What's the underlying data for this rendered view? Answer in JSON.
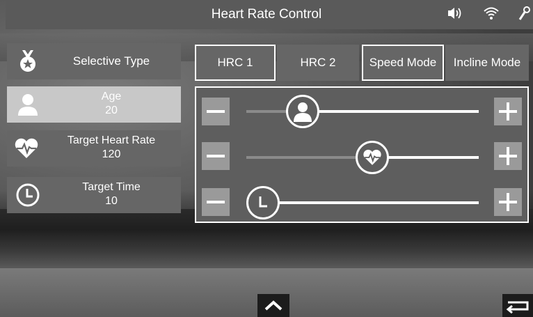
{
  "header": {
    "title": "Heart Rate Control",
    "icons": [
      "volume-icon",
      "wifi-icon",
      "wrench-icon"
    ]
  },
  "left_panel": {
    "items": [
      {
        "icon": "medal-icon",
        "label": "Selective Type",
        "value": "",
        "active": false
      },
      {
        "icon": "person-icon",
        "label": "Age",
        "value": "20",
        "active": true
      },
      {
        "icon": "heart-icon",
        "label": "Target Heart Rate",
        "value": "120",
        "active": false
      },
      {
        "icon": "clock-icon",
        "label": "Target Time",
        "value": "10",
        "active": false
      }
    ]
  },
  "tabs": [
    {
      "label": "HRC 1",
      "selected": true
    },
    {
      "label": "HRC 2",
      "selected": false
    },
    {
      "label": "Speed Mode",
      "selected": true
    },
    {
      "label": "Incline Mode",
      "selected": false
    }
  ],
  "sliders": [
    {
      "name": "age",
      "icon": "person-icon",
      "fraction": 0.17
    },
    {
      "name": "target-heart-rate",
      "icon": "heart-icon",
      "fraction": 0.47
    },
    {
      "name": "target-time",
      "icon": "clock-icon",
      "fraction": 0.0
    }
  ],
  "footer": {
    "up_icon": "chevron-up-icon",
    "back_icon": "return-icon"
  },
  "colors": {
    "card": "#666666",
    "card_active": "#c8c8c8",
    "button": "#9a9a9a",
    "text": "#ffffff"
  }
}
